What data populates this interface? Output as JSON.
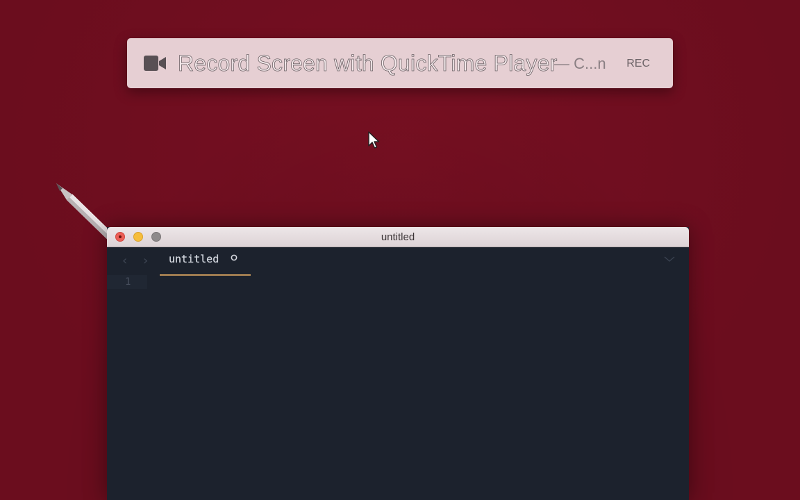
{
  "spotlight": {
    "query": "Record Screen with QuickTime Player",
    "suffix": "— C...n",
    "action_hint": "REC",
    "icon": "video-camera-icon"
  },
  "editor": {
    "window_title": "untitled",
    "tab": {
      "label": "untitled",
      "dirty_indicator": "unsaved-dot-icon"
    },
    "gutter": {
      "line_numbers": [
        "1"
      ]
    },
    "colors": {
      "background": "#1c222d",
      "tab_underline": "#c2935a",
      "desktop": "#6b0d1e"
    }
  }
}
